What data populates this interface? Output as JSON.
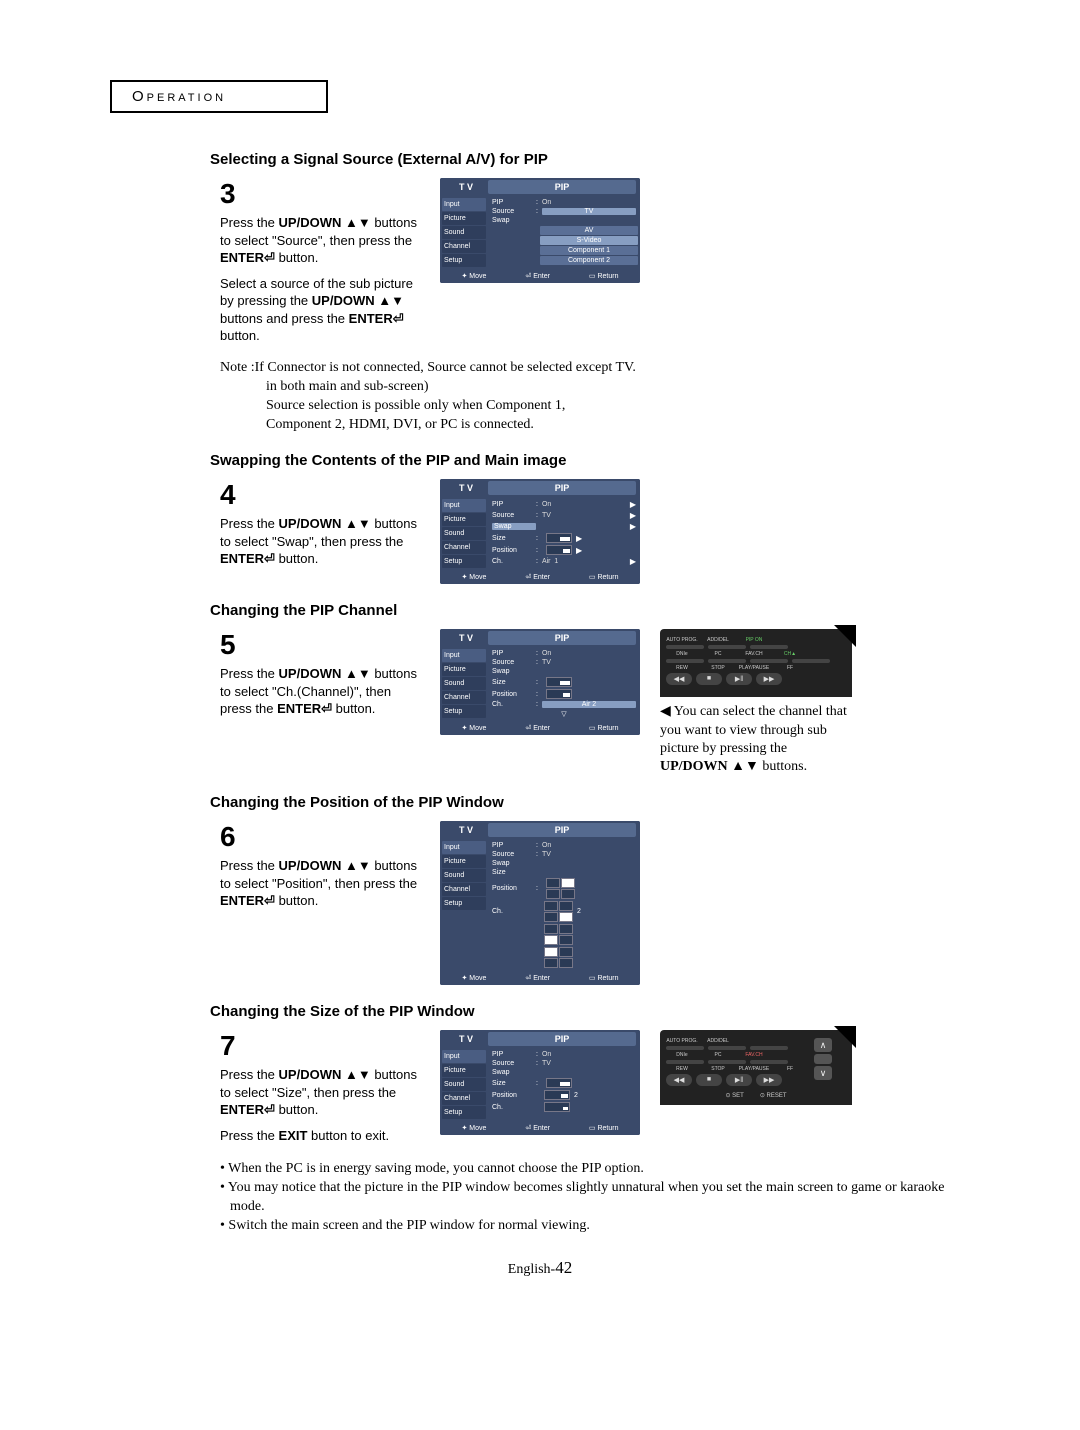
{
  "header": {
    "section": "Operation"
  },
  "subheads": {
    "s3": "Selecting a Signal Source (External A/V) for PIP",
    "s4": "Swapping the Contents of the PIP and Main image",
    "s5": "Changing the PIP Channel",
    "s6": "Changing the Position of the PIP Window",
    "s7": "Changing the Size of the PIP Window"
  },
  "steps": {
    "n3": "3",
    "n4": "4",
    "n5": "5",
    "n6": "6",
    "n7": "7",
    "press_the": "Press the ",
    "updown": "UP/DOWN ▲▼",
    "t3a": " buttons to select \"Source\", then press the ",
    "enter": "ENTER⏎",
    "t3a_end": " button.",
    "t3b_a": "Select a source of the sub picture by pressing the ",
    "t3b_b": " buttons and press the ",
    "t3b_c": " button.",
    "t4": " buttons to select \"Swap\", then press the ",
    "t4_end": " button.",
    "t5": " buttons to select \"Ch.(Channel)\", then press the ",
    "t5_end": " button.",
    "t6": " buttons to select \"Position\", then press the ",
    "t6_end": " button.",
    "t7": " buttons to select \"Size\", then press the ",
    "t7_end": " button.",
    "t7_exit_a": "Press the ",
    "t7_exit_b": "EXIT",
    "t7_exit_c": " button to exit."
  },
  "note": {
    "l1": "Note :If Connector is not connected, Source cannot be selected except TV.",
    "l2": "in both main and sub-screen)",
    "l3": "Source selection is possible only when Component 1,",
    "l4": "Component 2, HDMI, DVI, or PC is connected."
  },
  "osd": {
    "tv": "T V",
    "pip": "PIP",
    "side": [
      "Input",
      "Picture",
      "Sound",
      "Channel",
      "Setup"
    ],
    "rows": {
      "pip": "PIP",
      "source": "Source",
      "swap": "Swap",
      "size": "Size",
      "position": "Position",
      "ch": "Ch."
    },
    "vals": {
      "on": "On",
      "tv": "TV",
      "air": "Air",
      "one": "1",
      "two": "2",
      "air2": "Air     2"
    },
    "sources": [
      "TV",
      "AV",
      "S-Video",
      "Component 1",
      "Component 2"
    ],
    "foot": {
      "move": "✦ Move",
      "enter": "⏎ Enter",
      "return": "▭ Return"
    }
  },
  "remote": {
    "labels": {
      "autoprog": "AUTO PROG.",
      "adddel": "ADD/DEL",
      "pipon": "PIP ON",
      "dnie": "DNIe",
      "pc": "PC",
      "favch": "FAV.CH",
      "chup": "CH▲",
      "rew": "REW",
      "stop": "STOP",
      "playpause": "PLAY/PAUSE",
      "ff": "FF",
      "set": "⊙ SET",
      "reset": "⊙ RESET"
    },
    "btns": {
      "rew": "◀◀",
      "stop": "■",
      "play": "▶‖",
      "ff": "▶▶",
      "up": "∧",
      "down": "∨"
    },
    "caption_pre": "◀ You can select the channel that you want to view through sub picture by pressing the ",
    "caption_bold": "UP/DOWN ▲▼",
    "caption_post": " buttons."
  },
  "bullets": {
    "b1": "• When the PC is in energy saving mode, you cannot choose the PIP option.",
    "b2": "• You may notice that the picture in the PIP window becomes slightly unnatural when you set the main screen to game or karaoke mode.",
    "b3": "• Switch the main screen and the PIP window for normal viewing."
  },
  "footer": {
    "lang": "English-",
    "page": "42"
  }
}
